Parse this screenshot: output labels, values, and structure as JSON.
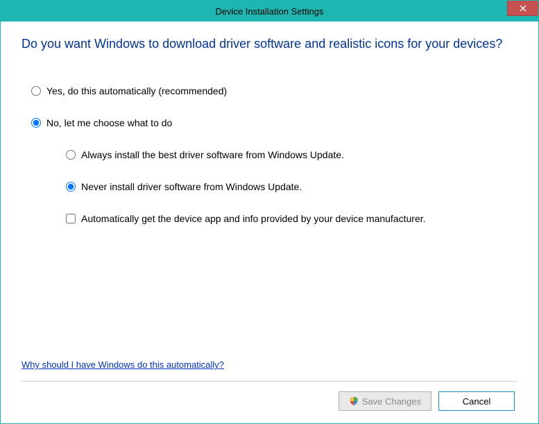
{
  "window": {
    "title": "Device Installation Settings"
  },
  "heading": "Do you want Windows to download driver software and realistic icons for your devices?",
  "options": {
    "yes": "Yes, do this automatically (recommended)",
    "no": "No, let me choose what to do",
    "sub_always": "Always install the best driver software from Windows Update.",
    "sub_never": "Never install driver software from Windows Update.",
    "sub_auto_app": "Automatically get the device app and info provided by your device manufacturer."
  },
  "help_link": "Why should I have Windows do this automatically?",
  "buttons": {
    "save": "Save Changes",
    "cancel": "Cancel"
  }
}
